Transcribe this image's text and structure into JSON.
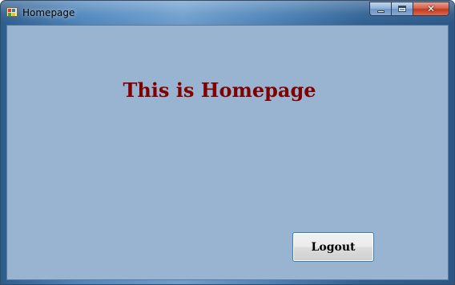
{
  "window": {
    "title": "Homepage",
    "app_icon": "form-app-icon",
    "caption_buttons": {
      "minimize_icon": "minimize-icon",
      "maximize_icon": "maximize-icon",
      "close_icon": "close-icon",
      "close_glyph": "✕"
    }
  },
  "main": {
    "heading": "This is Homepage",
    "heading_color": "#800000",
    "background_color": "#99b4d1",
    "logout_label": "Logout"
  }
}
